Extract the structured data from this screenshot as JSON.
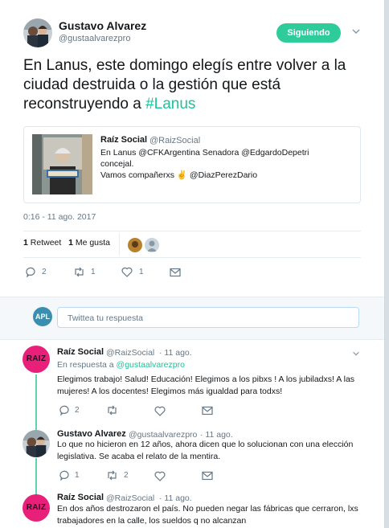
{
  "main_tweet": {
    "name": "Gustavo Alvarez",
    "handle": "@gustaalvarezpro",
    "follow_label": "Siguiendo",
    "text": "En Lanus, este domingo elegís entre volver a la ciudad destruida o la gestión que está reconstruyendo a ",
    "hashtag": "#Lanus",
    "timestamp": "0:16 - 11 ago. 2017",
    "retweet_count": "1",
    "retweet_label": "Retweet",
    "like_count": "1",
    "like_label": "Me gusta",
    "actions": {
      "replies": "2",
      "retweets": "1",
      "likes": "1"
    }
  },
  "quote": {
    "name": "Raíz Social",
    "handle": "@RaizSocial",
    "line1": "En Lanus @CFKArgentina Senadora @EdgardoDepetri",
    "line2": "concejal.",
    "line3": "Vamos compañerxs ✌ @DiazPerezDario"
  },
  "reply_box": {
    "avatar_text": "APL",
    "placeholder": "Twittea tu respuesta"
  },
  "replies": [
    {
      "avatar_text": "RAIZ",
      "name": "Raíz Social",
      "handle": "@RaizSocial",
      "time": "· 11 ago.",
      "reply_prefix": "En respuesta a ",
      "reply_to": "@gustaalvarezpro",
      "text": "Elegimos trabajo! Salud! Educación! Elegimos a los pibxs ! A los jubiladxs! A las mujeres! A los docentes! Elegimos más igualdad para todxs!",
      "replies": "2",
      "retweets": "",
      "likes": ""
    },
    {
      "name": "Gustavo Alvarez",
      "handle": "@gustaalvarezpro",
      "time": "· 11 ago.",
      "text": "Lo que no hicieron en 12 años, ahora dicen que lo solucionan con una elección legislativa. Se acaba el relato de la mentira.",
      "replies": "1",
      "retweets": "2",
      "likes": ""
    },
    {
      "avatar_text": "RAIZ",
      "name": "Raíz Social",
      "handle": "@RaizSocial",
      "time": "· 11 ago.",
      "text": "En dos años destrozaron el país. No pueden negar las fábricas que cerraron, lxs trabajadores  en la calle, los sueldos q no alcanzan"
    }
  ],
  "colors": {
    "accent": "#1dc39a",
    "follow": "#2ecc9a",
    "raiz_avatar": "#e8207a",
    "thread_line": "#5fd4b1"
  }
}
